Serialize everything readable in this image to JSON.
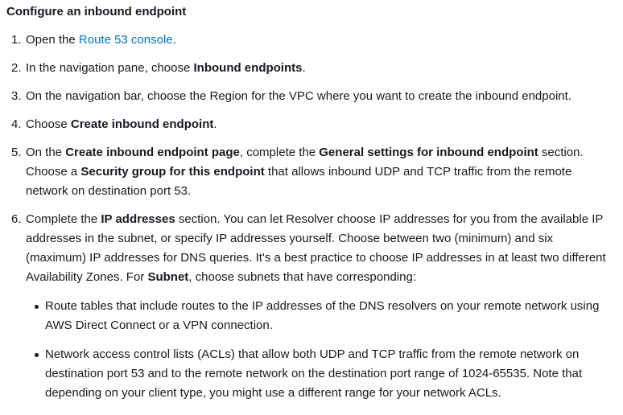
{
  "heading": "Configure an inbound endpoint",
  "steps": [
    {
      "num": "1.",
      "pre": "Open the ",
      "link": "Route 53 console",
      "post": "."
    },
    {
      "num": "2.",
      "pre": "In the navigation pane, choose ",
      "bold": "Inbound endpoints",
      "post": "."
    },
    {
      "num": "3.",
      "text": "On the navigation bar, choose the Region for the VPC where you want to create the inbound endpoint."
    },
    {
      "num": "4.",
      "pre": "Choose ",
      "bold": "Create inbound endpoint",
      "post": "."
    },
    {
      "num": "5.",
      "t1": "On the ",
      "b1": "Create inbound endpoint page",
      "t2": ", complete the ",
      "b2": "General settings for inbound endpoint",
      "t3": " section. Choose a ",
      "b3": "Security group for this endpoint",
      "t4": " that allows inbound UDP and TCP traffic from the remote network on destination port 53."
    },
    {
      "num": "6.",
      "t1": "Complete the ",
      "b1": "IP addresses",
      "t2": " section. You can let Resolver choose IP addresses for you from the available IP addresses in the subnet, or specify IP addresses yourself. Choose between two (minimum) and six (maximum) IP addresses for DNS queries. It's a best practice to choose IP addresses in at least two different Availability Zones. For ",
      "b2": "Subnet",
      "t3": ", choose subnets that have corresponding:",
      "bullets": [
        "Route tables that include routes to the IP addresses of the DNS resolvers on your remote network using AWS Direct Connect or a VPN connection.",
        "Network access control lists (ACLs) that allow both UDP and TCP traffic from the remote network on destination port 53 and to the remote network on the destination port range of 1024-65535. Note that depending on your client type, you might use a different range for your network ACLs."
      ]
    }
  ]
}
